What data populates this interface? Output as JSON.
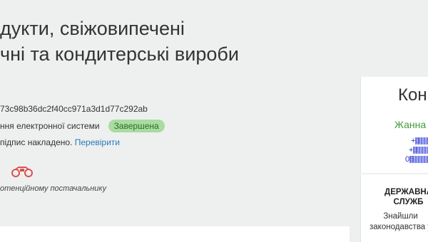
{
  "tender": {
    "title_line1": "дукти, свіжовипечені",
    "title_line2": "чні та кондитерські вироби",
    "id_line": "73c98b36dc2f40cc971a3d1d77c292ab",
    "status_label": "ння електронної системи",
    "status_badge": "Завершена",
    "signature_text": "підпис накладено.",
    "verify_link": "Перевірити",
    "supplier_note": "отенційному постачальнику"
  },
  "contact": {
    "title": "Кон",
    "name": "Жанна",
    "phone1": "+3",
    "phone2": "+3",
    "phone3": "05"
  },
  "service": {
    "title_line1": "ДЕРЖАВНА",
    "title_line2": "СЛУЖБ",
    "desc_line1": "Знайшли",
    "desc_line2": "законодавства у"
  },
  "colors": {
    "badge_bg": "#a8dca0",
    "link": "#2a7ab8",
    "accent_green": "#3f9a3a",
    "binoculars": "#d9534f"
  },
  "icons": {
    "supplier": "binoculars-icon"
  }
}
